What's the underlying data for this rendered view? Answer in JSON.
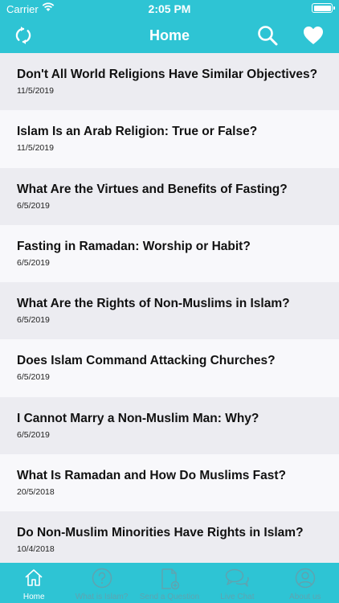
{
  "status": {
    "carrier": "Carrier",
    "time": "2:05 PM"
  },
  "navbar": {
    "title": "Home"
  },
  "items": [
    {
      "title": "Don't All World Religions Have Similar Objectives?",
      "date": "11/5/2019"
    },
    {
      "title": "Islam Is an Arab Religion: True or False?",
      "date": "11/5/2019"
    },
    {
      "title": "What Are the Virtues and Benefits of Fasting?",
      "date": "6/5/2019"
    },
    {
      "title": "Fasting in Ramadan: Worship or Habit?",
      "date": "6/5/2019"
    },
    {
      "title": "What Are the Rights of Non-Muslims in Islam?",
      "date": "6/5/2019"
    },
    {
      "title": "Does Islam Command Attacking Churches?",
      "date": "6/5/2019"
    },
    {
      "title": "I Cannot Marry a Non-Muslim Man: Why?",
      "date": "6/5/2019"
    },
    {
      "title": "What Is Ramadan and How Do Muslims Fast?",
      "date": "20/5/2018"
    },
    {
      "title": "Do Non-Muslim Minorities Have Rights in Islam?",
      "date": "10/4/2018"
    }
  ],
  "tabs": [
    {
      "label": "Home",
      "icon": "home-icon"
    },
    {
      "label": "What is Islam?",
      "icon": "question-icon"
    },
    {
      "label": "Send a Question",
      "icon": "compose-icon"
    },
    {
      "label": "Live Chat",
      "icon": "chat-icon"
    },
    {
      "label": "About us",
      "icon": "user-icon"
    }
  ],
  "colors": {
    "accent": "#2ec4d4",
    "inactive_tab": "#5fa3b0"
  }
}
